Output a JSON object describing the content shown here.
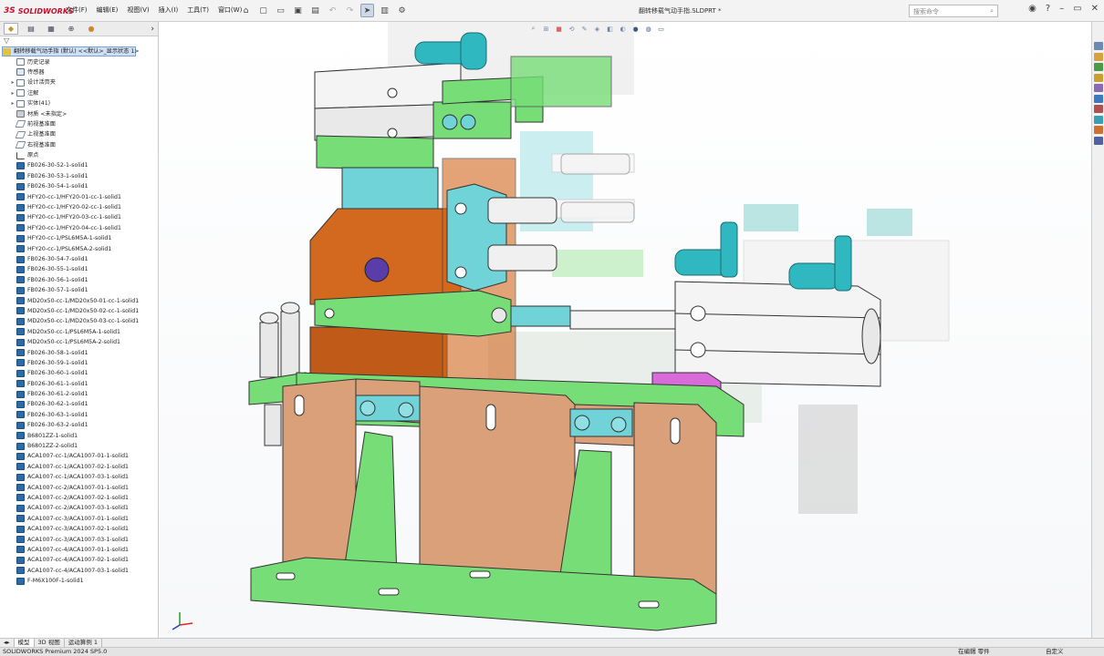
{
  "app": {
    "logo_prefix": "3S",
    "logo_text": "SOLIDWORKS",
    "document_title": "翻转移载气动手指.SLDPRT *",
    "search_placeholder": "搜索命令",
    "search_icon": "magnifier-icon"
  },
  "menu": [
    "文件(F)",
    "编辑(E)",
    "视图(V)",
    "插入(I)",
    "工具(T)",
    "窗口(W)"
  ],
  "toolbar_icons": [
    "home-icon",
    "new-icon",
    "open-icon",
    "save-icon",
    "print-icon",
    "undo-icon",
    "redo-icon",
    "select-icon",
    "rebuild-icon",
    "options-icon"
  ],
  "feature_manager": {
    "tabs": [
      "feature-tree-icon",
      "property-icon",
      "config-icon",
      "dimxpert-icon",
      "display-icon"
    ],
    "root": "翻转移载气动手指 (默认) <<默认>_显示状态 1>",
    "nodes": [
      {
        "label": "历史记录",
        "icon": "folder",
        "exp": ""
      },
      {
        "label": "传感器",
        "icon": "sensor",
        "exp": ""
      },
      {
        "label": "设计活页夹",
        "icon": "folder",
        "exp": "▸"
      },
      {
        "label": "注解",
        "icon": "folder",
        "exp": "▸"
      },
      {
        "label": "实体(41)",
        "icon": "folder",
        "exp": "▸"
      },
      {
        "label": "材质 <未指定>",
        "icon": "mat",
        "exp": ""
      },
      {
        "label": "前视基准面",
        "icon": "plane",
        "exp": ""
      },
      {
        "label": "上视基准面",
        "icon": "plane",
        "exp": ""
      },
      {
        "label": "右视基准面",
        "icon": "plane",
        "exp": ""
      },
      {
        "label": "原点",
        "icon": "origin",
        "exp": ""
      }
    ],
    "bodies": [
      "FB026-30-52-1-solid1",
      "FB026-30-53-1-solid1",
      "FB026-30-54-1-solid1",
      "HFY20-cc-1/HFY20-01-cc-1-solid1",
      "HFY20-cc-1/HFY20-02-cc-1-solid1",
      "HFY20-cc-1/HFY20-03-cc-1-solid1",
      "HFY20-cc-1/HFY20-04-cc-1-solid1",
      "HFY20-cc-1/PSL6M5A-1-solid1",
      "HFY20-cc-1/PSL6M5A-2-solid1",
      "FB026-30-54-7-solid1",
      "FB026-30-55-1-solid1",
      "FB026-30-56-1-solid1",
      "FB026-30-57-1-solid1",
      "MD20x50-cc-1/MD20x50-01-cc-1-solid1",
      "MD20x50-cc-1/MD20x50-02-cc-1-solid1",
      "MD20x50-cc-1/MD20x50-03-cc-1-solid1",
      "MD20x50-cc-1/PSL6M5A-1-solid1",
      "MD20x50-cc-1/PSL6M5A-2-solid1",
      "FB026-30-58-1-solid1",
      "FB026-30-59-1-solid1",
      "FB026-30-60-1-solid1",
      "FB026-30-61-1-solid1",
      "FB026-30-61-2-solid1",
      "FB026-30-62-1-solid1",
      "FB026-30-63-1-solid1",
      "FB026-30-63-2-solid1",
      "B6801ZZ-1-solid1",
      "B6801ZZ-2-solid1",
      "ACA1007-cc-1/ACA1007-01-1-solid1",
      "ACA1007-cc-1/ACA1007-02-1-solid1",
      "ACA1007-cc-1/ACA1007-03-1-solid1",
      "ACA1007-cc-2/ACA1007-01-1-solid1",
      "ACA1007-cc-2/ACA1007-02-1-solid1",
      "ACA1007-cc-2/ACA1007-03-1-solid1",
      "ACA1007-cc-3/ACA1007-01-1-solid1",
      "ACA1007-cc-3/ACA1007-02-1-solid1",
      "ACA1007-cc-3/ACA1007-03-1-solid1",
      "ACA1007-cc-4/ACA1007-01-1-solid1",
      "ACA1007-cc-4/ACA1007-02-1-solid1",
      "ACA1007-cc-4/ACA1007-03-1-solid1",
      "F-M6X100F-1-solid1"
    ]
  },
  "bottom_tabs": [
    "模型",
    "3D 视图",
    "运动算例 1"
  ],
  "status": {
    "left": "SOLIDWORKS Premium 2024 SP5.0",
    "editing": "在编辑 零件",
    "units": "自定义"
  },
  "colors": {
    "green": "#77dd77",
    "orange": "#d2691e",
    "tan": "#d9a07a",
    "cyan": "#6fd3d8",
    "magenta": "#d96ad9",
    "selection": "#cfe0f4"
  }
}
